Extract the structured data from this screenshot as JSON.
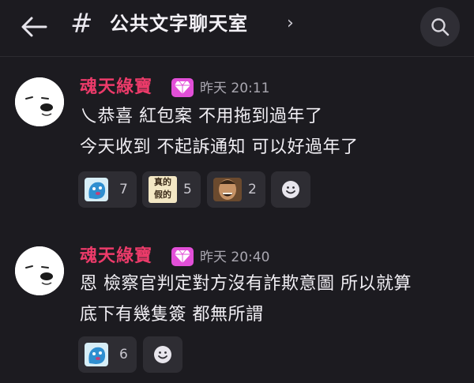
{
  "header": {
    "back_icon": "arrow-left-icon",
    "channel_hash": "#",
    "channel_name": "公共文字聊天室",
    "chevron": "›",
    "search_icon": "search-icon"
  },
  "messages": [
    {
      "username": "魂天綠寶",
      "badge_icon": "diamond-icon",
      "timestamp": "昨天 20:11",
      "lines": [
        "乀恭喜 紅包案 不用拖到過年了",
        "今天收到 不起訴通知 可以好過年了"
      ],
      "reactions": [
        {
          "sticker": "blue-blob-sticker",
          "count": "7"
        },
        {
          "sticker_text": [
            "真的",
            "假的"
          ],
          "count": "5"
        },
        {
          "sticker": "laughing-man-sticker",
          "count": "2"
        }
      ]
    },
    {
      "username": "魂天綠寶",
      "badge_icon": "diamond-icon",
      "timestamp": "昨天 20:40",
      "lines": [
        "恩 檢察官判定對方沒有詐欺意圖 所以就算",
        "底下有幾隻簽 都無所謂"
      ],
      "reactions": [
        {
          "sticker": "blue-blob-sticker",
          "count": "6"
        }
      ]
    }
  ],
  "colors": {
    "background": "#1c1b20",
    "username": "#ec3b6a",
    "badge": "#e24fd8",
    "reaction_bg": "#2e2d33"
  }
}
